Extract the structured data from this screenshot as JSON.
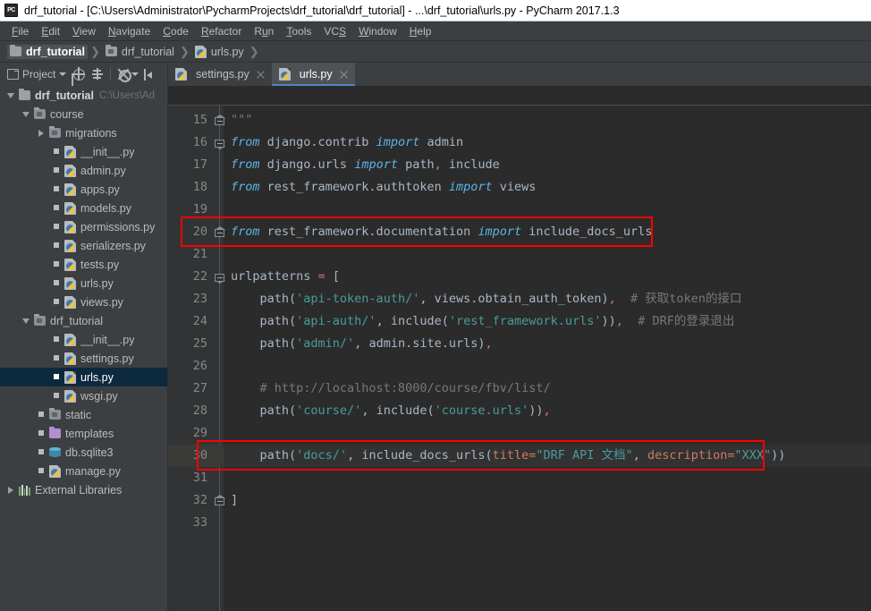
{
  "window": {
    "title": "drf_tutorial - [C:\\Users\\Administrator\\PycharmProjects\\drf_tutorial\\drf_tutorial] - ...\\drf_tutorial\\urls.py - PyCharm 2017.1.3",
    "app_icon": "pycharm-icon"
  },
  "menubar": {
    "items": [
      {
        "label": "File",
        "mnemonic": "F"
      },
      {
        "label": "Edit",
        "mnemonic": "E"
      },
      {
        "label": "View",
        "mnemonic": "V"
      },
      {
        "label": "Navigate",
        "mnemonic": "N"
      },
      {
        "label": "Code",
        "mnemonic": "C"
      },
      {
        "label": "Refactor",
        "mnemonic": "R"
      },
      {
        "label": "Run",
        "mnemonic": "u"
      },
      {
        "label": "Tools",
        "mnemonic": "T"
      },
      {
        "label": "VCS",
        "mnemonic": "S"
      },
      {
        "label": "Window",
        "mnemonic": "W"
      },
      {
        "label": "Help",
        "mnemonic": "H"
      }
    ]
  },
  "navbar": {
    "crumbs": [
      {
        "label": "drf_tutorial",
        "icon": "folder-icon",
        "selected": true
      },
      {
        "label": "drf_tutorial",
        "icon": "folder-icon",
        "selected": false
      },
      {
        "label": "urls.py",
        "icon": "python-file-icon",
        "selected": false
      }
    ],
    "separator": "❯"
  },
  "toolstrip": {
    "project_label": "Project",
    "buttons": [
      "target-icon",
      "collapse-all-icon",
      "settings-gear-icon",
      "hide-panel-icon"
    ]
  },
  "editor_tabs": [
    {
      "label": "settings.py",
      "icon": "python-file-icon",
      "active": false,
      "close": "close-icon"
    },
    {
      "label": "urls.py",
      "icon": "python-file-icon",
      "active": true,
      "close": "close-icon"
    }
  ],
  "project_tree": [
    {
      "label": "drf_tutorial",
      "path": "C:\\Users\\Ad",
      "indent": 0,
      "arrow": "open",
      "icon": "folder-icon",
      "bold": true,
      "selected": false
    },
    {
      "label": "course",
      "path": "",
      "indent": 1,
      "arrow": "open",
      "icon": "folder-module-icon",
      "bold": false,
      "selected": false
    },
    {
      "label": "migrations",
      "path": "",
      "indent": 2,
      "arrow": "closed",
      "icon": "folder-module-icon",
      "bold": false,
      "selected": false
    },
    {
      "label": "__init__.py",
      "path": "",
      "indent": 3,
      "arrow": "none",
      "icon": "python-file-icon",
      "bold": false,
      "selected": false
    },
    {
      "label": "admin.py",
      "path": "",
      "indent": 3,
      "arrow": "none",
      "icon": "python-file-icon",
      "bold": false,
      "selected": false
    },
    {
      "label": "apps.py",
      "path": "",
      "indent": 3,
      "arrow": "none",
      "icon": "python-file-icon",
      "bold": false,
      "selected": false
    },
    {
      "label": "models.py",
      "path": "",
      "indent": 3,
      "arrow": "none",
      "icon": "python-file-icon",
      "bold": false,
      "selected": false
    },
    {
      "label": "permissions.py",
      "path": "",
      "indent": 3,
      "arrow": "none",
      "icon": "python-file-icon",
      "bold": false,
      "selected": false
    },
    {
      "label": "serializers.py",
      "path": "",
      "indent": 3,
      "arrow": "none",
      "icon": "python-file-icon",
      "bold": false,
      "selected": false
    },
    {
      "label": "tests.py",
      "path": "",
      "indent": 3,
      "arrow": "none",
      "icon": "python-file-icon",
      "bold": false,
      "selected": false
    },
    {
      "label": "urls.py",
      "path": "",
      "indent": 3,
      "arrow": "none",
      "icon": "python-file-icon",
      "bold": false,
      "selected": false
    },
    {
      "label": "views.py",
      "path": "",
      "indent": 3,
      "arrow": "none",
      "icon": "python-file-icon",
      "bold": false,
      "selected": false
    },
    {
      "label": "drf_tutorial",
      "path": "",
      "indent": 1,
      "arrow": "open",
      "icon": "folder-module-icon",
      "bold": false,
      "selected": false
    },
    {
      "label": "__init__.py",
      "path": "",
      "indent": 3,
      "arrow": "none",
      "icon": "python-file-icon",
      "bold": false,
      "selected": false
    },
    {
      "label": "settings.py",
      "path": "",
      "indent": 3,
      "arrow": "none",
      "icon": "python-file-icon",
      "bold": false,
      "selected": false
    },
    {
      "label": "urls.py",
      "path": "",
      "indent": 3,
      "arrow": "none",
      "icon": "python-file-icon",
      "bold": false,
      "selected": true
    },
    {
      "label": "wsgi.py",
      "path": "",
      "indent": 3,
      "arrow": "none",
      "icon": "python-file-icon",
      "bold": false,
      "selected": false
    },
    {
      "label": "static",
      "path": "",
      "indent": 2,
      "arrow": "none",
      "icon": "folder-module-icon",
      "bold": false,
      "selected": false
    },
    {
      "label": "templates",
      "path": "",
      "indent": 2,
      "arrow": "none",
      "icon": "folder-violet-icon",
      "bold": false,
      "selected": false
    },
    {
      "label": "db.sqlite3",
      "path": "",
      "indent": 2,
      "arrow": "none",
      "icon": "database-icon",
      "bold": false,
      "selected": false
    },
    {
      "label": "manage.py",
      "path": "",
      "indent": 2,
      "arrow": "none",
      "icon": "python-file-icon",
      "bold": false,
      "selected": false
    },
    {
      "label": "External Libraries",
      "path": "",
      "indent": 0,
      "arrow": "closed",
      "icon": "libraries-icon",
      "bold": false,
      "selected": false
    }
  ],
  "editor": {
    "filename": "urls.py",
    "current_line": 30,
    "first_line": 15,
    "last_line": 33,
    "line_numbers": [
      15,
      16,
      17,
      18,
      19,
      20,
      21,
      22,
      23,
      24,
      25,
      26,
      27,
      28,
      29,
      30,
      31,
      32,
      33
    ],
    "fold_lines": [
      15,
      16,
      20,
      22,
      32
    ],
    "colors": {
      "background": "#2b2b2b",
      "gutter": "#313335",
      "current_line": "#323232",
      "keyword": "#5cb3e8",
      "string": "#4a9b9b",
      "comment": "#787878",
      "operator": "#d76ba0",
      "parameter": "#cf7c5f",
      "text": "#a9b7c6",
      "annotation_box": "#ff0000"
    },
    "lines": [
      {
        "n": 15,
        "tokens": [
          {
            "t": "\"\"\"",
            "c": "cmt"
          }
        ]
      },
      {
        "n": 16,
        "tokens": [
          {
            "t": "from",
            "c": "kw"
          },
          {
            "t": " django.contrib ",
            "c": "plain"
          },
          {
            "t": "import",
            "c": "kw"
          },
          {
            "t": " admin",
            "c": "plain"
          }
        ]
      },
      {
        "n": 17,
        "tokens": [
          {
            "t": "from",
            "c": "kw"
          },
          {
            "t": " django.urls ",
            "c": "plain"
          },
          {
            "t": "import",
            "c": "kw"
          },
          {
            "t": " path",
            "c": "plain"
          },
          {
            "t": ",",
            "c": "op"
          },
          {
            "t": " include",
            "c": "plain"
          }
        ]
      },
      {
        "n": 18,
        "tokens": [
          {
            "t": "from",
            "c": "kw"
          },
          {
            "t": " rest_framework.authtoken ",
            "c": "plain"
          },
          {
            "t": "import",
            "c": "kw"
          },
          {
            "t": " views",
            "c": "plain"
          }
        ]
      },
      {
        "n": 19,
        "tokens": []
      },
      {
        "n": 20,
        "tokens": [
          {
            "t": "from",
            "c": "kw"
          },
          {
            "t": " rest_framework.documentation ",
            "c": "plain"
          },
          {
            "t": "import",
            "c": "kw"
          },
          {
            "t": " include_docs_urls",
            "c": "plain"
          }
        ]
      },
      {
        "n": 21,
        "tokens": []
      },
      {
        "n": 22,
        "tokens": [
          {
            "t": "urlpatterns ",
            "c": "plain"
          },
          {
            "t": "=",
            "c": "op"
          },
          {
            "t": " [",
            "c": "plain"
          }
        ]
      },
      {
        "n": 23,
        "tokens": [
          {
            "t": "    path(",
            "c": "plain"
          },
          {
            "t": "'api-token-auth/'",
            "c": "str"
          },
          {
            "t": ", views.obtain_auth_token)",
            "c": "plain"
          },
          {
            "t": ",",
            "c": "op"
          },
          {
            "t": "  # 获取token的接口",
            "c": "cmt"
          }
        ]
      },
      {
        "n": 24,
        "tokens": [
          {
            "t": "    path(",
            "c": "plain"
          },
          {
            "t": "'api-auth/'",
            "c": "str"
          },
          {
            "t": ", include(",
            "c": "plain"
          },
          {
            "t": "'rest_framework.urls'",
            "c": "str"
          },
          {
            "t": "))",
            "c": "plain"
          },
          {
            "t": ",",
            "c": "op"
          },
          {
            "t": "  # DRF的登录退出",
            "c": "cmt"
          }
        ]
      },
      {
        "n": 25,
        "tokens": [
          {
            "t": "    path(",
            "c": "plain"
          },
          {
            "t": "'admin/'",
            "c": "str"
          },
          {
            "t": ", admin.site.urls)",
            "c": "plain"
          },
          {
            "t": ",",
            "c": "op"
          }
        ]
      },
      {
        "n": 26,
        "tokens": []
      },
      {
        "n": 27,
        "tokens": [
          {
            "t": "    # http://localhost:8000/course/fbv/list/",
            "c": "cmt"
          }
        ]
      },
      {
        "n": 28,
        "tokens": [
          {
            "t": "    path(",
            "c": "plain"
          },
          {
            "t": "'course/'",
            "c": "str"
          },
          {
            "t": ", include(",
            "c": "plain"
          },
          {
            "t": "'course.urls'",
            "c": "str"
          },
          {
            "t": "))",
            "c": "plain"
          },
          {
            "t": ",",
            "c": "op"
          }
        ]
      },
      {
        "n": 29,
        "tokens": []
      },
      {
        "n": 30,
        "tokens": [
          {
            "t": "    path(",
            "c": "plain"
          },
          {
            "t": "'docs/'",
            "c": "str"
          },
          {
            "t": ", include_docs_urls(",
            "c": "plain"
          },
          {
            "t": "title=",
            "c": "param"
          },
          {
            "t": "\"DRF API 文档\"",
            "c": "str"
          },
          {
            "t": ", ",
            "c": "plain"
          },
          {
            "t": "description=",
            "c": "param"
          },
          {
            "t": "\"XXX\"",
            "c": "str"
          },
          {
            "t": "))",
            "c": "plain"
          }
        ]
      },
      {
        "n": 31,
        "tokens": []
      },
      {
        "n": 32,
        "tokens": [
          {
            "t": "]",
            "c": "plain"
          }
        ]
      },
      {
        "n": 33,
        "tokens": []
      }
    ],
    "annotations": [
      {
        "name": "red-box-import-line",
        "line": 20,
        "label": ""
      },
      {
        "name": "red-box-docs-path-line",
        "line": 30,
        "label": ""
      }
    ]
  }
}
